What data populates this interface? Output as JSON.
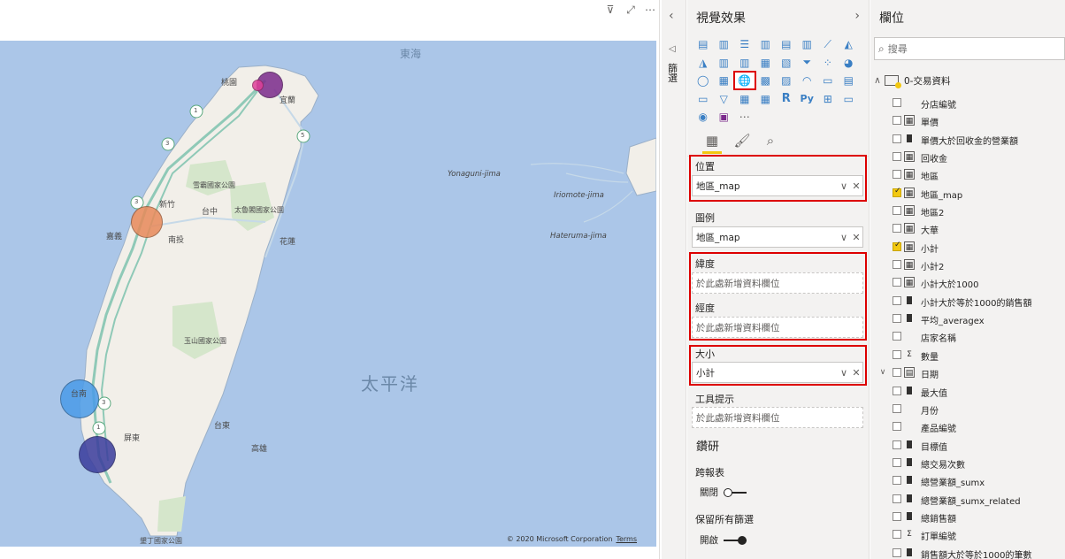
{
  "map": {
    "sea_east": "東海",
    "ocean": "太平洋",
    "islands": [
      "Yonaguni-jima",
      "Iriomote-jima",
      "Hateruma-jima"
    ],
    "parks": [
      "雪霸國家公園",
      "太魯閣國家公園",
      "玉山國家公園",
      "墾丁國家公園"
    ],
    "cities": [
      "桃園",
      "新竹",
      "台中",
      "南投",
      "台東",
      "花蓮",
      "嘉義",
      "台南",
      "高雄",
      "屏東",
      "宜蘭"
    ],
    "route_markers": [
      "1",
      "3",
      "3",
      "1",
      "5",
      "3",
      "1"
    ],
    "copyright": "© 2020 Microsoft Corporation",
    "terms": "Terms",
    "bubbles": [
      {
        "region": "台北",
        "color": "#7b2a8c"
      },
      {
        "region": "新北",
        "color": "#e0409a"
      },
      {
        "region": "台中",
        "color": "#e88a5a"
      },
      {
        "region": "台南",
        "color": "#4a9be8"
      },
      {
        "region": "高雄",
        "color": "#3a3c9c"
      }
    ]
  },
  "filters_strip": {
    "label": "篩選"
  },
  "viz_pane": {
    "title": "視覺效果",
    "tabs": [
      "fields-tab",
      "format-tab",
      "analytics-tab"
    ],
    "wells": {
      "location": {
        "label": "位置",
        "value": "地區_map"
      },
      "legend": {
        "label": "圖例",
        "value": "地區_map"
      },
      "latitude": {
        "label": "緯度",
        "placeholder": "於此處新增資料欄位"
      },
      "longitude": {
        "label": "經度",
        "placeholder": "於此處新增資料欄位"
      },
      "size": {
        "label": "大小",
        "value": "小計"
      },
      "tooltips": {
        "label": "工具提示",
        "placeholder": "於此處新增資料欄位"
      }
    },
    "drill": {
      "title": "鑽研",
      "cross_report": {
        "label": "跨報表",
        "state": "關閉"
      },
      "keep_filters": {
        "label": "保留所有篩選",
        "state": "開啟"
      }
    }
  },
  "fields_pane": {
    "title": "欄位",
    "search_placeholder": "搜尋",
    "table_name": "0-交易資料",
    "fields": [
      {
        "name": "分店編號",
        "type": "none",
        "checked": false,
        "expand": ""
      },
      {
        "name": "單價",
        "type": "table",
        "checked": false,
        "expand": ""
      },
      {
        "name": "單價大於回收金的營業額",
        "type": "calc",
        "checked": false,
        "expand": ""
      },
      {
        "name": "回收金",
        "type": "table",
        "checked": false,
        "expand": ""
      },
      {
        "name": "地區",
        "type": "table",
        "checked": false,
        "expand": ""
      },
      {
        "name": "地區_map",
        "type": "table",
        "checked": true,
        "expand": ""
      },
      {
        "name": "地區2",
        "type": "table",
        "checked": false,
        "expand": ""
      },
      {
        "name": "大華",
        "type": "table",
        "checked": false,
        "expand": ""
      },
      {
        "name": "小計",
        "type": "table",
        "checked": true,
        "expand": ""
      },
      {
        "name": "小計2",
        "type": "table",
        "checked": false,
        "expand": ""
      },
      {
        "name": "小計大於1000",
        "type": "table",
        "checked": false,
        "expand": ""
      },
      {
        "name": "小計大於等於1000的銷售額",
        "type": "calc",
        "checked": false,
        "expand": ""
      },
      {
        "name": "平均_averagex",
        "type": "calc",
        "checked": false,
        "expand": ""
      },
      {
        "name": "店家名稱",
        "type": "none",
        "checked": false,
        "expand": ""
      },
      {
        "name": "數量",
        "type": "sigma",
        "checked": false,
        "expand": ""
      },
      {
        "name": "日期",
        "type": "date",
        "checked": false,
        "expand": "∨"
      },
      {
        "name": "最大值",
        "type": "calc",
        "checked": false,
        "expand": ""
      },
      {
        "name": "月份",
        "type": "none",
        "checked": false,
        "expand": ""
      },
      {
        "name": "產品編號",
        "type": "none",
        "checked": false,
        "expand": ""
      },
      {
        "name": "目標值",
        "type": "calc",
        "checked": false,
        "expand": ""
      },
      {
        "name": "總交易次數",
        "type": "calc",
        "checked": false,
        "expand": ""
      },
      {
        "name": "總營業額_sumx",
        "type": "calc",
        "checked": false,
        "expand": ""
      },
      {
        "name": "總營業額_sumx_related",
        "type": "calc",
        "checked": false,
        "expand": ""
      },
      {
        "name": "總銷售額",
        "type": "calc",
        "checked": false,
        "expand": ""
      },
      {
        "name": "訂單編號",
        "type": "sigma",
        "checked": false,
        "expand": ""
      },
      {
        "name": "銷售額大於等於1000的筆數",
        "type": "calc",
        "checked": false,
        "expand": ""
      }
    ]
  }
}
